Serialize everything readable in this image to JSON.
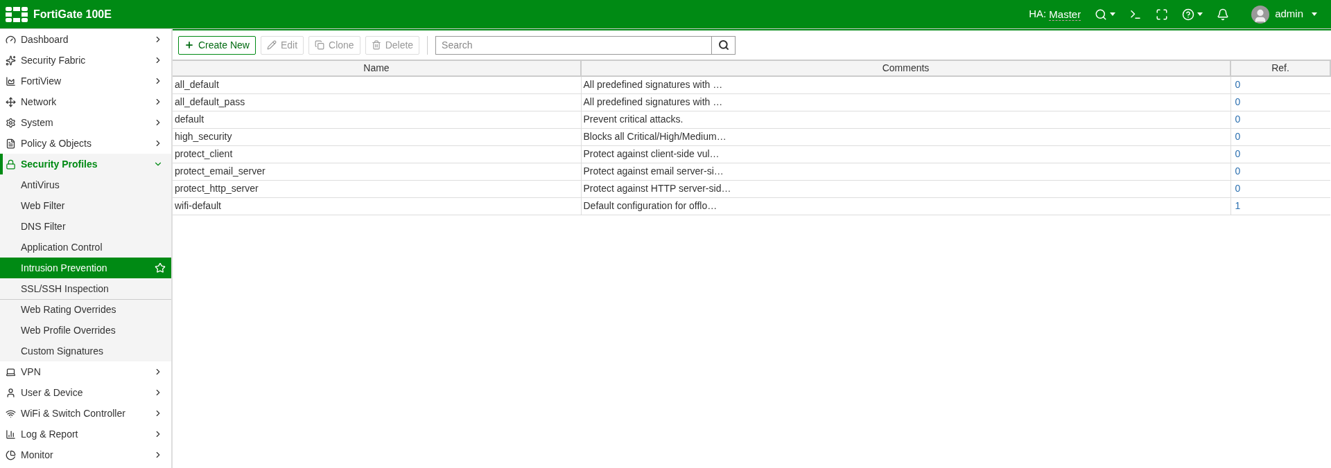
{
  "header": {
    "title": "FortiGate 100E",
    "ha_label": "HA:",
    "ha_value": "Master",
    "user": "admin"
  },
  "sidebar": {
    "items": [
      {
        "label": "Dashboard",
        "expanded": false,
        "selected": false
      },
      {
        "label": "Security Fabric",
        "expanded": false,
        "selected": false
      },
      {
        "label": "FortiView",
        "expanded": false,
        "selected": false
      },
      {
        "label": "Network",
        "expanded": false,
        "selected": false
      },
      {
        "label": "System",
        "expanded": false,
        "selected": false
      },
      {
        "label": "Policy & Objects",
        "expanded": false,
        "selected": false
      },
      {
        "label": "Security Profiles",
        "expanded": true,
        "selected": false,
        "children": [
          {
            "label": "AntiVirus",
            "selected": false,
            "divider_before": false
          },
          {
            "label": "Web Filter",
            "selected": false,
            "divider_before": false
          },
          {
            "label": "DNS Filter",
            "selected": false,
            "divider_before": false
          },
          {
            "label": "Application Control",
            "selected": false,
            "divider_before": false
          },
          {
            "label": "Intrusion Prevention",
            "selected": true,
            "divider_before": false
          },
          {
            "label": "SSL/SSH Inspection",
            "selected": false,
            "divider_before": false
          },
          {
            "label": "Web Rating Overrides",
            "selected": false,
            "divider_before": true
          },
          {
            "label": "Web Profile Overrides",
            "selected": false,
            "divider_before": false
          },
          {
            "label": "Custom Signatures",
            "selected": false,
            "divider_before": false
          }
        ]
      },
      {
        "label": "VPN",
        "expanded": false,
        "selected": false
      },
      {
        "label": "User & Device",
        "expanded": false,
        "selected": false
      },
      {
        "label": "WiFi & Switch Controller",
        "expanded": false,
        "selected": false
      },
      {
        "label": "Log & Report",
        "expanded": false,
        "selected": false
      },
      {
        "label": "Monitor",
        "expanded": false,
        "selected": false
      }
    ]
  },
  "toolbar": {
    "buttons": [
      {
        "label": "Create New",
        "disabled": false
      },
      {
        "label": "Edit",
        "disabled": true
      },
      {
        "label": "Clone",
        "disabled": true
      },
      {
        "label": "Delete",
        "disabled": true
      }
    ],
    "search": {
      "placeholder": "Search"
    }
  },
  "table": {
    "columns": [
      "Name",
      "Comments",
      "Ref."
    ],
    "rows": [
      {
        "name": "all_default",
        "comments": "All predefined signatures with …",
        "ref": "0"
      },
      {
        "name": "all_default_pass",
        "comments": "All predefined signatures with …",
        "ref": "0"
      },
      {
        "name": "default",
        "comments": "Prevent critical attacks.",
        "ref": "0"
      },
      {
        "name": "high_security",
        "comments": "Blocks all Critical/High/Medium…",
        "ref": "0"
      },
      {
        "name": "protect_client",
        "comments": "Protect against client-side vul…",
        "ref": "0"
      },
      {
        "name": "protect_email_server",
        "comments": "Protect against email server-si…",
        "ref": "0"
      },
      {
        "name": "protect_http_server",
        "comments": "Protect against HTTP server-sid…",
        "ref": "0"
      },
      {
        "name": "wifi-default",
        "comments": "Default configuration for offlo…",
        "ref": "1"
      }
    ]
  }
}
